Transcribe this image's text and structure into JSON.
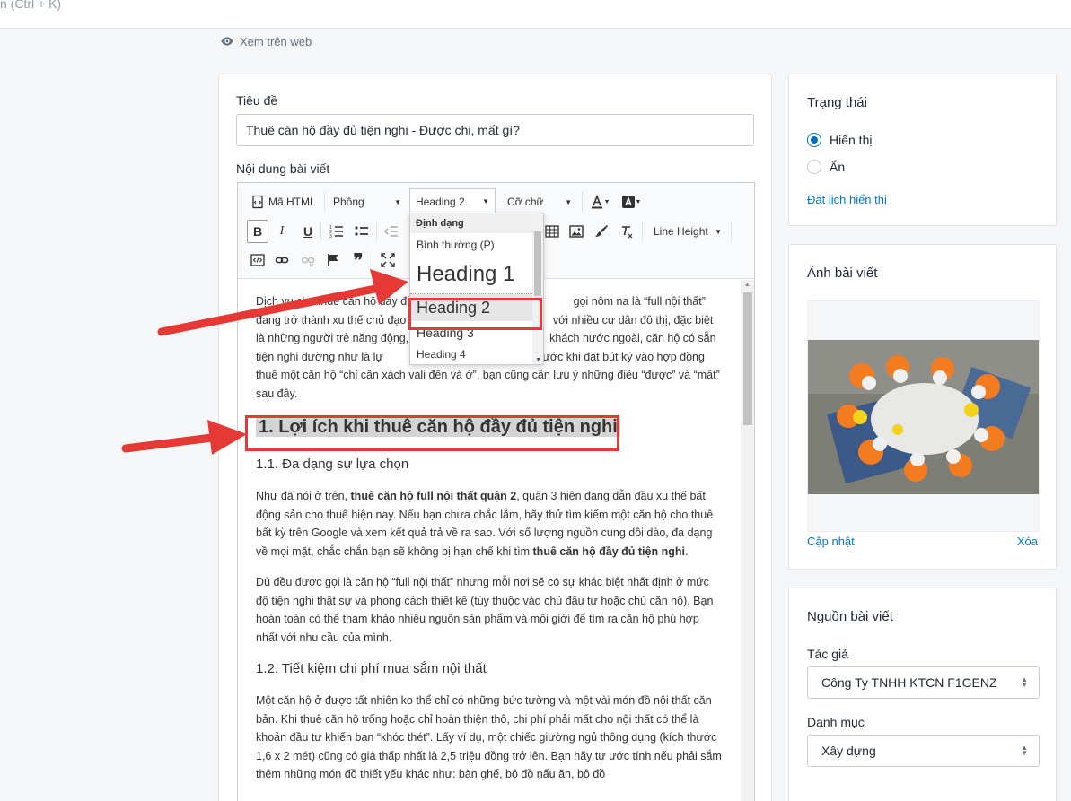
{
  "topbar": {
    "search_hint": "n (Ctrl + K)"
  },
  "view_web": {
    "label": "Xem trên web"
  },
  "post": {
    "title_label": "Tiêu đề",
    "title_value": "Thuê căn hộ đầy đủ tiện nghi - Được chi, mất gì?",
    "content_label": "Nội dung bài viết"
  },
  "toolbar": {
    "html_label": "Mã HTML",
    "font_label": "Phông",
    "format_label": "Heading 2",
    "size_label": "Cỡ chữ",
    "lineheight_label": "Line Height",
    "bold": "B",
    "italic": "I",
    "underline": "U"
  },
  "format_menu": {
    "header": "Định dạng",
    "options": [
      "Bình thường (P)",
      "Heading 1",
      "Heading 2",
      "Heading 3",
      "Heading 4"
    ]
  },
  "body": {
    "intro_a": "Dịch vụ cho thuê căn hộ đầy đủ ",
    "intro_b": "gọi nôm na là “full nội thất” đang trở thành xu thế chủ đạo trên ",
    "intro_c": "với nhiều cư dân đô thị, đặc biệt là những người trẻ năng động, t",
    "intro_d": "khách nước ngoài, căn hộ có sẵn tiện nghi dường như là lự",
    "intro_e": "iên trước khi đặt bút ký vào hợp đồng thuê một căn hộ “chỉ cần xách vali đến và ở”, bạn cũng cần lưu ý những điều “được” và “mất” sau đây.",
    "h2_1": "1. Lợi ích khi thuê căn hộ đầy đủ tiện nghi",
    "h3_1": "1.1. Đa dạng sự lựa chọn",
    "p1_a": "Như đã nói ở trên, ",
    "p1_b": "thuê căn hộ full nội thất quận 2",
    "p1_c": ", quận 3 hiện đang dẫn đầu xu thế bất động sản cho thuê hiện nay. Nếu bạn chưa chắc lắm, hãy thử tìm kiếm một căn hộ cho thuê bất kỳ trên Google và xem kết quả trả về ra sao. Với số lượng nguồn cung dồi dào, đa dạng về mọi mặt, chắc chắn bạn sẽ không bị hạn chế khi tìm ",
    "p1_d": "thuê căn hộ đầy đủ tiện nghi",
    "p1_e": ".",
    "p2": "Dù đều được gọi là căn hộ “full nội thất” nhưng mỗi nơi sẽ có sự khác biệt nhất định ở mức độ tiện nghi thật sự và phong cách thiết kế (tùy thuộc vào chủ đầu tư hoặc chủ căn hộ). Bạn hoàn toàn có thể tham khảo nhiều nguồn sản phẩm và môi giới để tìm ra căn hộ phù hợp nhất với nhu cầu của mình.",
    "h3_2": "1.2. Tiết kiệm chi phí mua sắm nội thất",
    "p3": "Một căn hộ ở được tất nhiên ko thể chỉ có những bức tường và một vài món đồ nội thất căn bản. Khi thuê căn hộ trống hoặc chỉ hoàn thiện thô, chi phí phải mất cho nội thất có thể là khoản đầu tư khiến bạn “khóc thét”. Lấy ví dụ, một chiếc giường ngủ thông dụng (kích thước 1,6 x 2 mét) cũng có giá thấp nhất là 2,5 triệu đồng trở lên. Bạn hãy tự ước tính nếu phải sắm thêm những món đồ thiết yếu khác như: bàn ghế, bộ đồ nấu ăn, bộ đồ"
  },
  "status": {
    "title": "Trạng thái",
    "options": [
      "Hiển thị",
      "Ẩn"
    ],
    "selected": 0,
    "schedule_link": "Đặt lịch hiển thị"
  },
  "image": {
    "title": "Ảnh bài viết",
    "update_link": "Cập nhật",
    "delete_link": "Xóa"
  },
  "source": {
    "title": "Nguồn bài viết",
    "author_label": "Tác giả",
    "author_value": "Công Ty TNHH KTCN F1GENZ",
    "category_label": "Danh mục",
    "category_value": "Xây dựng"
  },
  "colors": {
    "accent": "#006fbb",
    "link": "#007ace",
    "highlight": "#e53935"
  },
  "icons": [
    "eye-icon",
    "html-code-icon",
    "bold-icon",
    "italic-icon",
    "underline-icon",
    "ordered-list-icon",
    "unordered-list-icon",
    "outdent-icon",
    "table-icon",
    "image-icon",
    "brush-icon",
    "clear-format-icon",
    "code-view-icon",
    "link-icon",
    "unlink-icon",
    "flag-icon",
    "quote-icon",
    "fullscreen-icon",
    "text-color-icon",
    "bg-color-icon",
    "arrow-annotation-icon"
  ]
}
